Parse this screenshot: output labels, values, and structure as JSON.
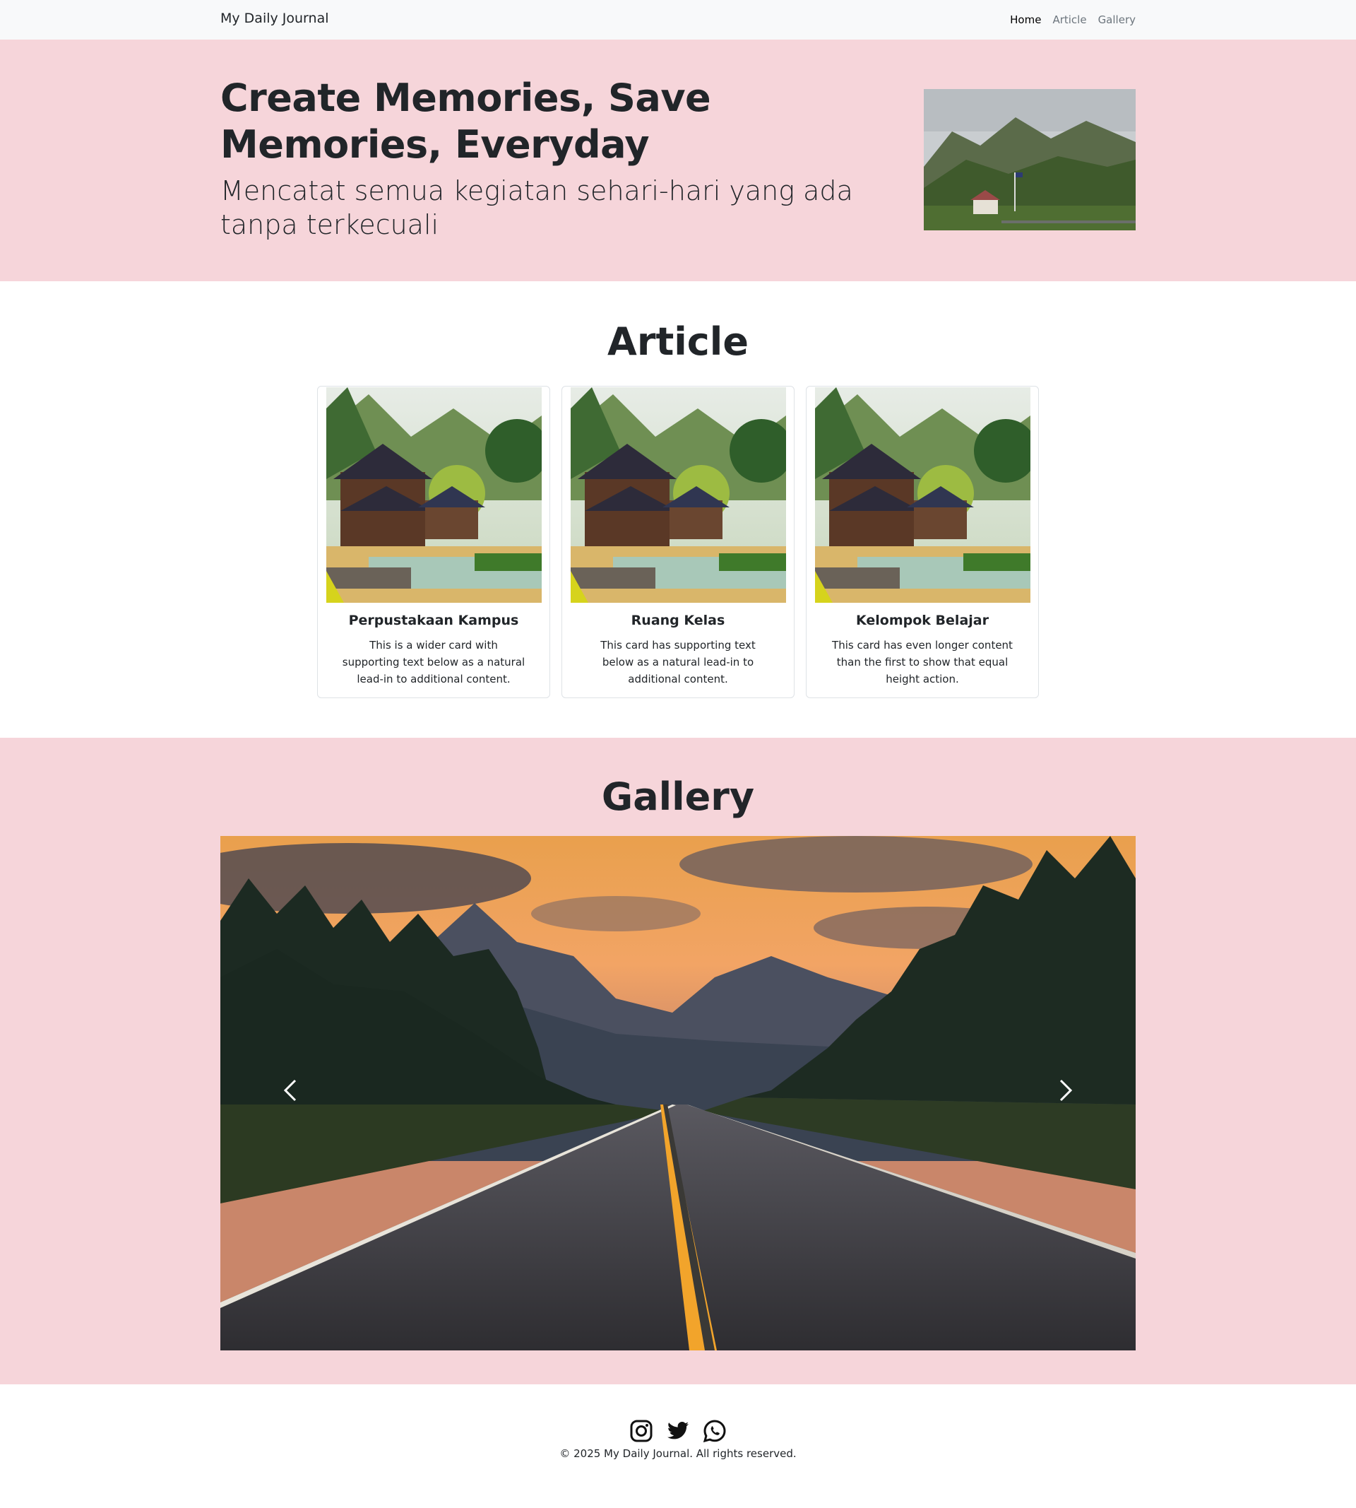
{
  "nav": {
    "brand": "My Daily Journal",
    "items": [
      {
        "label": "Home"
      },
      {
        "label": "Article"
      },
      {
        "label": "Gallery"
      }
    ]
  },
  "hero": {
    "title": "Create Memories, Save Memories, Everyday",
    "subtitle": "Mencatat semua kegiatan sehari-hari yang ada tanpa terkecuali",
    "image_icon": "mountain-landscape-image"
  },
  "article": {
    "title": "Article",
    "cards": [
      {
        "title": "Perpustakaan Kampus",
        "text": "This is a wider card with supporting text below as a natural lead-in to additional content."
      },
      {
        "title": "Ruang Kelas",
        "text": "This card has supporting text below as a natural lead-in to additional content."
      },
      {
        "title": "Kelompok Belajar",
        "text": "This card has even longer content than the first to show that equal height action."
      }
    ]
  },
  "gallery": {
    "title": "Gallery",
    "prev_icon": "chevron-left-icon",
    "next_icon": "chevron-right-icon"
  },
  "footer": {
    "icons": [
      "instagram-icon",
      "twitter-icon",
      "whatsapp-icon"
    ],
    "copyright": "© 2025 My Daily Journal. All rights reserved."
  },
  "colors": {
    "section_pink": "#f6d5da",
    "navbar_bg": "#f8f9fa",
    "text": "#212529"
  }
}
